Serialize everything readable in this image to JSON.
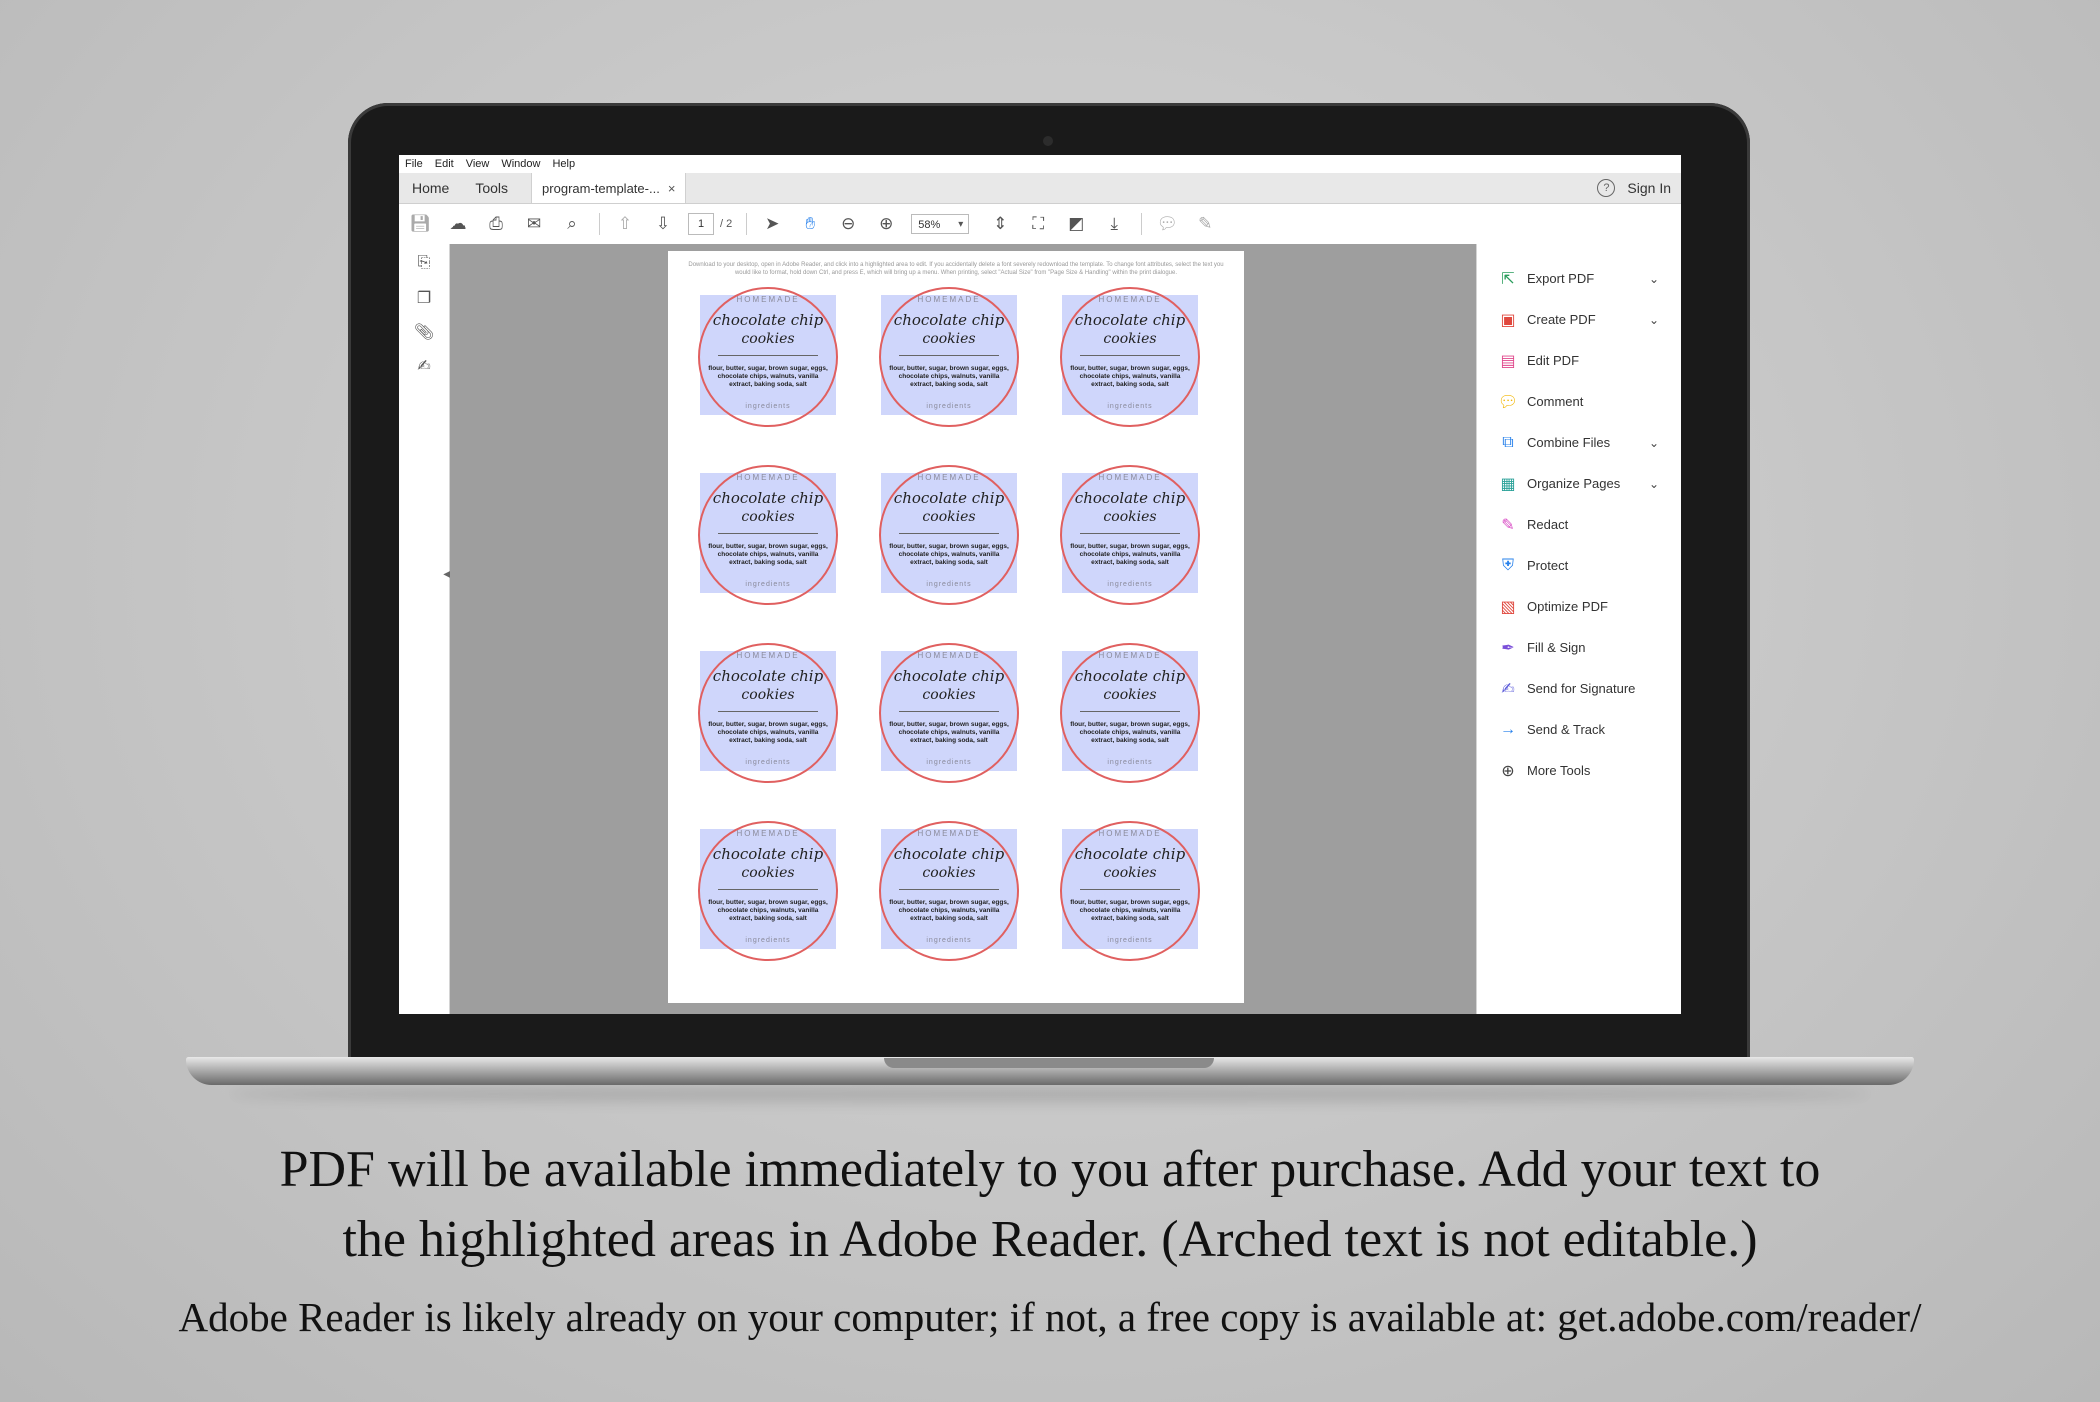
{
  "menubar": [
    "File",
    "Edit",
    "View",
    "Window",
    "Help"
  ],
  "tabs": {
    "home": "Home",
    "tools": "Tools",
    "document": "program-template-...",
    "close": "×",
    "help": "?",
    "sign_in": "Sign In"
  },
  "toolbar": {
    "page_current": "1",
    "page_total": "/ 2",
    "zoom": "58%"
  },
  "document": {
    "instructions": "Download to your desktop, open in Adobe Reader, and click into a highlighted area to edit. If you accidentally delete a font severely redownload the template. To change font attributes, select the text you would like to format, hold down Ctrl, and press E, which will bring up a menu. When printing, select \"Actual Size\" from \"Page Size & Handling\" within the print dialogue.",
    "label": {
      "top": "HOMEMADE",
      "script_line1": "chocolate chip",
      "script_line2": "cookies",
      "ingredients": "flour, butter, sugar, brown sugar, eggs, chocolate chips, walnuts, vanilla extract, baking soda, salt",
      "bottom": "ingredients"
    }
  },
  "tools_pane": [
    {
      "label": "Export PDF",
      "icon": "export-pdf-icon",
      "color": "#2a9d5c",
      "chevron": true
    },
    {
      "label": "Create PDF",
      "icon": "create-pdf-icon",
      "color": "#e0483e",
      "chevron": true
    },
    {
      "label": "Edit PDF",
      "icon": "edit-pdf-icon",
      "color": "#e0488c",
      "chevron": false
    },
    {
      "label": "Comment",
      "icon": "comment-icon",
      "color": "#f2b705",
      "chevron": false
    },
    {
      "label": "Combine Files",
      "icon": "combine-files-icon",
      "color": "#2680eb",
      "chevron": true
    },
    {
      "label": "Organize Pages",
      "icon": "organize-pages-icon",
      "color": "#2aa198",
      "chevron": true
    },
    {
      "label": "Redact",
      "icon": "redact-icon",
      "color": "#d94bc4",
      "chevron": false
    },
    {
      "label": "Protect",
      "icon": "protect-icon",
      "color": "#2680eb",
      "chevron": false
    },
    {
      "label": "Optimize PDF",
      "icon": "optimize-pdf-icon",
      "color": "#e0483e",
      "chevron": false
    },
    {
      "label": "Fill & Sign",
      "icon": "fill-sign-icon",
      "color": "#7b4fd9",
      "chevron": false
    },
    {
      "label": "Send for Signature",
      "icon": "send-signature-icon",
      "color": "#5a5ad9",
      "chevron": false
    },
    {
      "label": "Send & Track",
      "icon": "send-track-icon",
      "color": "#2680eb",
      "chevron": false
    },
    {
      "label": "More Tools",
      "icon": "more-tools-icon",
      "color": "#444444",
      "chevron": false
    }
  ],
  "caption": {
    "line1": "PDF will be available immediately to you after purchase.  Add your text to",
    "line2": "the highlighted areas in Adobe Reader.  (Arched text is not editable.)",
    "line3": "Adobe Reader is likely already on your computer; if not, a free copy is available at: get.adobe.com/reader/"
  }
}
